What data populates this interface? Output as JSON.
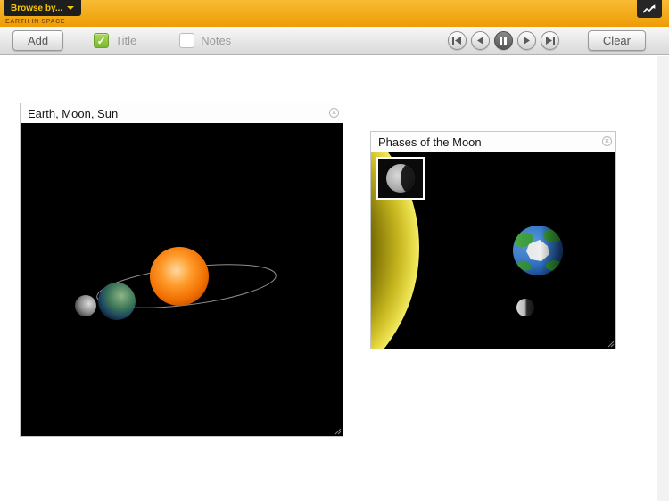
{
  "header": {
    "browse_label": "Browse by...",
    "app_label": "EARTH IN SPACE"
  },
  "toolbar": {
    "add_label": "Add",
    "title_label": "Title",
    "title_checked": true,
    "notes_label": "Notes",
    "notes_checked": false,
    "clear_label": "Clear",
    "media_controls": [
      "skip-start",
      "step-back",
      "pause",
      "step-forward",
      "skip-end"
    ],
    "active_media_control": "pause"
  },
  "icons": {
    "check": "✓",
    "close": "×"
  },
  "panels": [
    {
      "title": "Earth, Moon, Sun"
    },
    {
      "title": "Phases of the Moon"
    }
  ],
  "colors": {
    "header_orange": "#f0a718",
    "accent_green": "#7cb82f",
    "sun_orange": "#f07000",
    "sun_yellow": "#e8dc48",
    "canvas_black": "#000000"
  }
}
